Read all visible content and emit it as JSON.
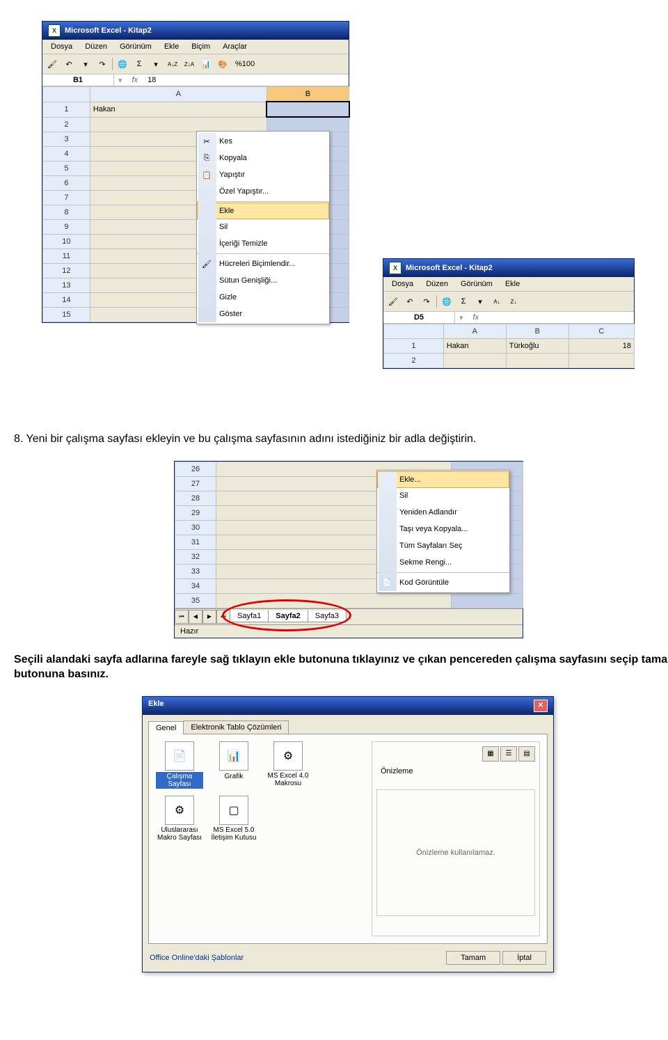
{
  "win1": {
    "app_title": "Microsoft Excel - Kitap2",
    "menu": [
      "Dosya",
      "Düzen",
      "Görünüm",
      "Ekle",
      "Biçim",
      "Araçlar"
    ],
    "zoom": "%100",
    "namebox": "B1",
    "formula": "18",
    "col_headers": [
      "A",
      "B"
    ],
    "rows": [
      "1",
      "2",
      "3",
      "4",
      "5",
      "6",
      "7",
      "8",
      "9",
      "10",
      "11",
      "12",
      "13",
      "14",
      "15"
    ],
    "cell_a1": "Hakan",
    "context_menu": {
      "items": [
        {
          "icon": "✂",
          "label": "Kes"
        },
        {
          "icon": "📄",
          "label": "Kopyala"
        },
        {
          "icon": "📋",
          "label": "Yapıştır"
        },
        {
          "icon": "",
          "label": "Özel Yapıştır..."
        },
        {
          "icon": "",
          "label": "Ekle",
          "sep_before": true,
          "highlight": true
        },
        {
          "icon": "",
          "label": "Sil"
        },
        {
          "icon": "",
          "label": "İçeriği Temizle"
        },
        {
          "icon": "🖌",
          "label": "Hücreleri Biçimlendir...",
          "sep_before": true
        },
        {
          "icon": "",
          "label": "Sütun Genişliği..."
        },
        {
          "icon": "",
          "label": "Gizle"
        },
        {
          "icon": "",
          "label": "Göster"
        }
      ]
    }
  },
  "win2": {
    "app_title": "Microsoft Excel - Kitap2",
    "menu": [
      "Dosya",
      "Düzen",
      "Görünüm",
      "Ekle"
    ],
    "namebox": "D5",
    "col_headers": [
      "A",
      "B",
      "C"
    ],
    "row1": [
      "Hakan",
      "Türkoğlu",
      "18"
    ],
    "row_numbers": [
      "1",
      "2"
    ]
  },
  "para1": "8. Yeni bir çalışma sayfası ekleyin ve bu çalışma sayfasının adını istediğiniz bir adla değiştirin.",
  "fig2": {
    "rows": [
      "26",
      "27",
      "28",
      "29",
      "30",
      "31",
      "32",
      "33",
      "34",
      "35"
    ],
    "tabs": [
      "Sayfa1",
      "Sayfa2",
      "Sayfa3"
    ],
    "status": "Hazır",
    "context_menu": {
      "items": [
        {
          "icon": "",
          "label": "Ekle...",
          "highlight": true
        },
        {
          "icon": "",
          "label": "Sil"
        },
        {
          "icon": "",
          "label": "Yeniden Adlandır"
        },
        {
          "icon": "",
          "label": "Taşı veya Kopyala..."
        },
        {
          "icon": "",
          "label": "Tüm Sayfaları Seç"
        },
        {
          "icon": "",
          "label": "Sekme Rengi..."
        },
        {
          "icon": "🔍",
          "label": "Kod Görüntüle"
        }
      ]
    }
  },
  "para2": "Seçili alandaki sayfa adlarına fareyle sağ tıklayın ekle butonuna tıklayınız ve çıkan pencereden çalışma sayfasını seçip tamam butonuna basınız.",
  "dialog": {
    "title": "Ekle",
    "tabs": [
      "Genel",
      "Elektronik Tablo Çözümleri"
    ],
    "templates": [
      {
        "label": "Çalışma Sayfası",
        "selected": true
      },
      {
        "label": "Grafik"
      },
      {
        "label": "MS Excel 4.0 Makrosu"
      },
      {
        "label": "Uluslararası Makro Sayfası"
      },
      {
        "label": "MS Excel 5.0 İletişim Kutusu"
      }
    ],
    "preview_label": "Önizleme",
    "preview_text": "Önizleme kullanılamaz.",
    "link": "Office Online'daki Şablonlar",
    "btn_ok": "Tamam",
    "btn_cancel": "İptal"
  }
}
